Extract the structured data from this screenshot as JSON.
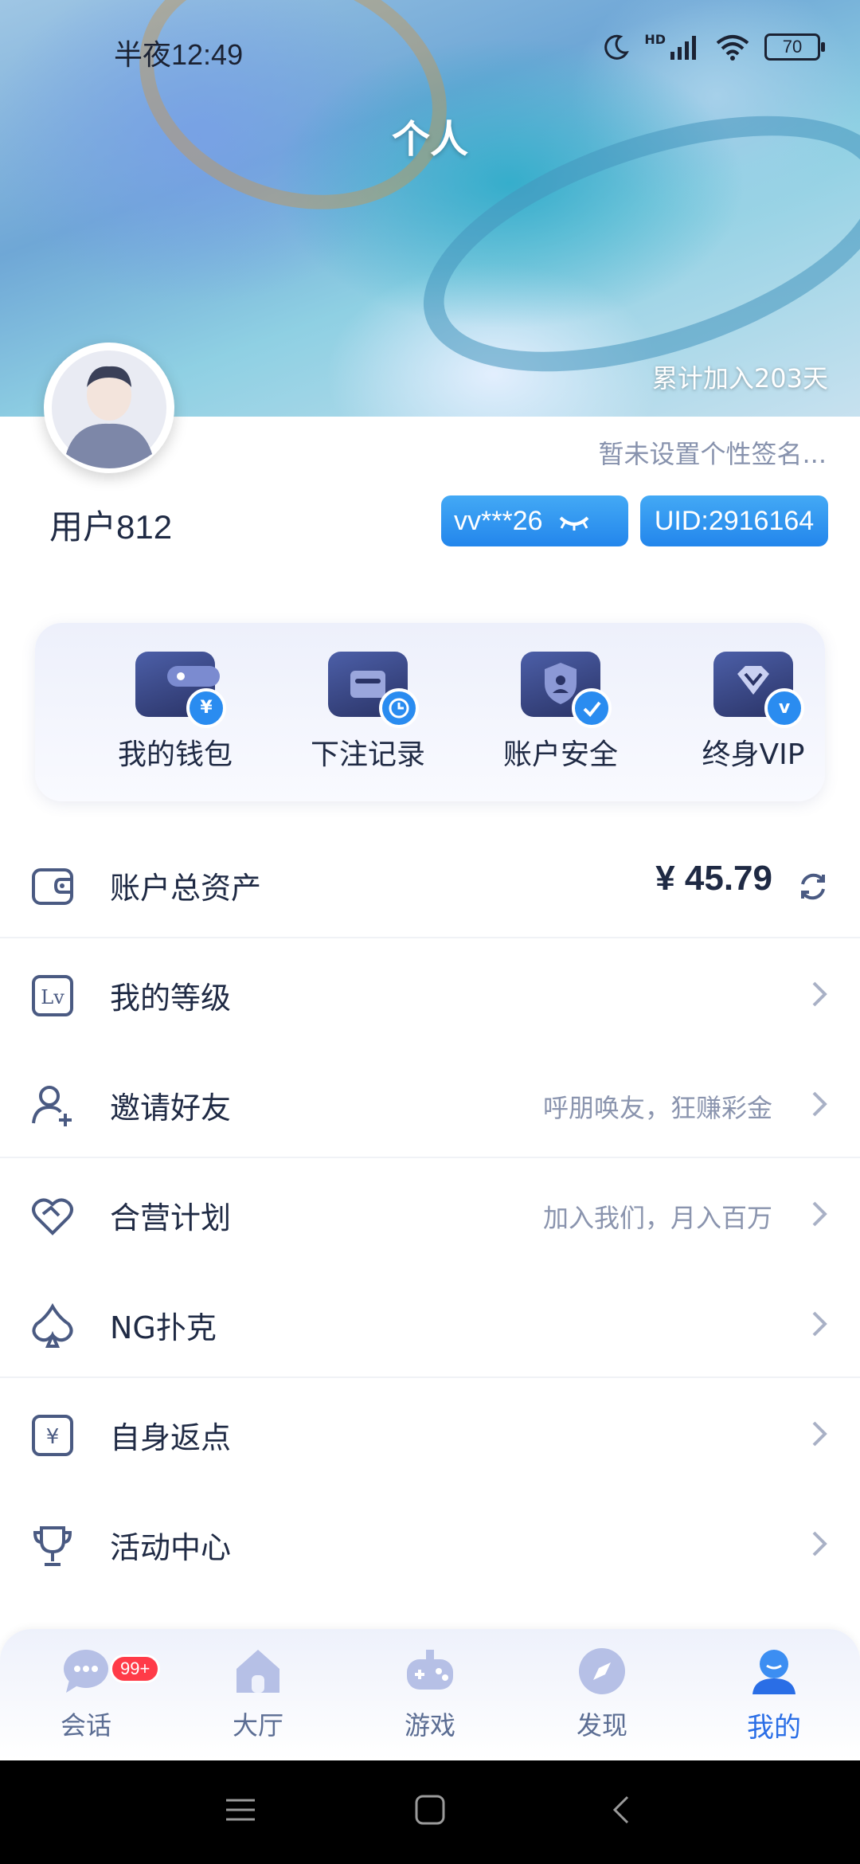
{
  "status_bar": {
    "time": "半夜12:49",
    "battery": "70",
    "network": "HD"
  },
  "header": {
    "title": "个人",
    "joined": "累计加入203天"
  },
  "profile": {
    "username": "用户812",
    "signature": "暂未设置个性签名...",
    "account_masked": "vv***26",
    "uid": "UID:2916164"
  },
  "quick_actions": [
    {
      "label": "我的钱包",
      "icon": "wallet-icon",
      "badge": "¥"
    },
    {
      "label": "下注记录",
      "icon": "bet-record-icon",
      "badge": "clock"
    },
    {
      "label": "账户安全",
      "icon": "shield-icon",
      "badge": "check"
    },
    {
      "label": "终身VIP",
      "icon": "vip-diamond-icon",
      "badge": "v"
    }
  ],
  "menu": {
    "assets": {
      "label": "账户总资产",
      "amount": "¥ 45.79",
      "icon": "wallet-outline-icon"
    },
    "level": {
      "label": "我的等级",
      "icon": "level-icon"
    },
    "invite": {
      "label": "邀请好友",
      "sub": "呼朋唤友，狂赚彩金",
      "icon": "add-user-icon"
    },
    "partner": {
      "label": "合营计划",
      "sub": "加入我们，月入百万",
      "icon": "handshake-heart-icon"
    },
    "poker": {
      "label": "NG扑克",
      "icon": "spade-icon"
    },
    "rebate": {
      "label": "自身返点",
      "icon": "yuan-icon"
    },
    "events": {
      "label": "活动中心",
      "icon": "trophy-icon"
    }
  },
  "bottom_nav": {
    "items": [
      {
        "label": "会话",
        "icon": "chat-icon",
        "badge": "99+"
      },
      {
        "label": "大厅",
        "icon": "home-icon"
      },
      {
        "label": "游戏",
        "icon": "gamepad-icon"
      },
      {
        "label": "发现",
        "icon": "compass-icon"
      },
      {
        "label": "我的",
        "icon": "profile-icon",
        "active": true
      }
    ]
  },
  "colors": {
    "accent": "#2a86ec",
    "text": "#1f2a44",
    "muted": "#8a94ae",
    "badge": "#ff3b48"
  }
}
